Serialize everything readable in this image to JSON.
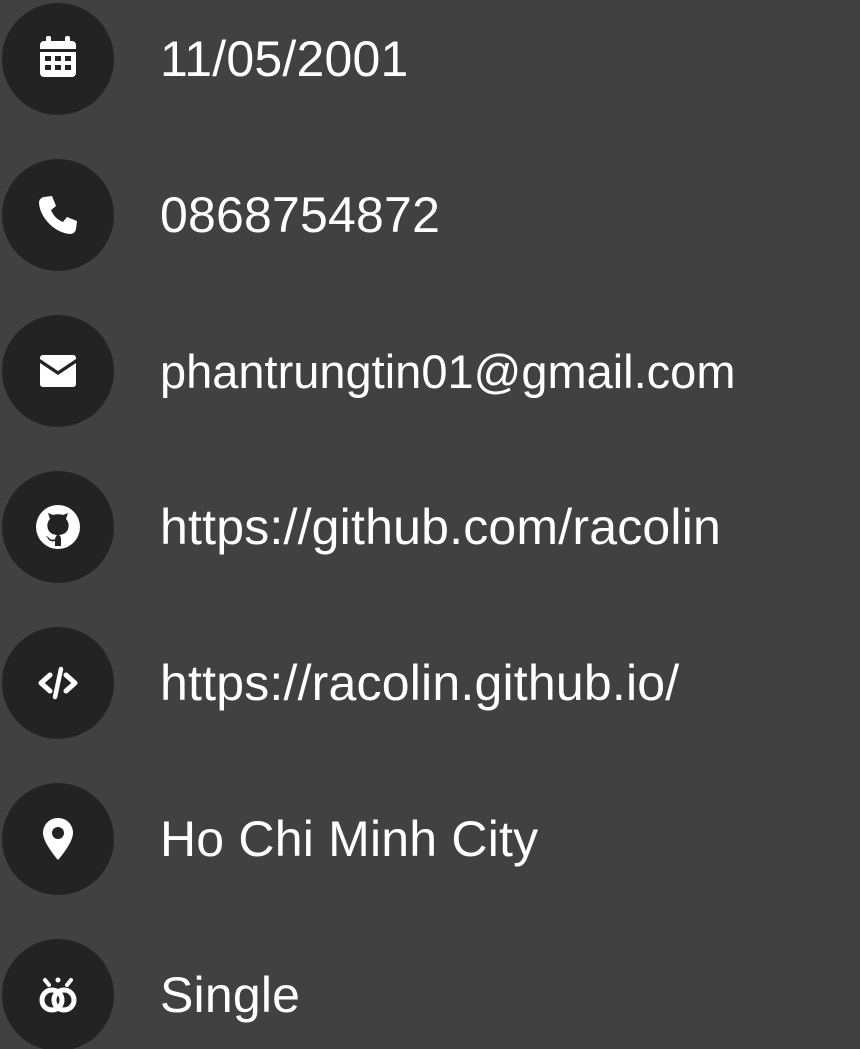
{
  "colors": {
    "background": "#414141",
    "icon_circle": "#232323",
    "foreground": "#ffffff"
  },
  "items": [
    {
      "icon": "calendar-icon",
      "text": "11/05/2001"
    },
    {
      "icon": "phone-icon",
      "text": "0868754872"
    },
    {
      "icon": "envelope-icon",
      "text": "phantrungtin01@gmail.com"
    },
    {
      "icon": "github-icon",
      "text": "https://github.com/racolin"
    },
    {
      "icon": "code-icon",
      "text": "https://racolin.github.io/"
    },
    {
      "icon": "location-pin-icon",
      "text": "Ho Chi Minh City"
    },
    {
      "icon": "rings-icon",
      "text": "Single"
    }
  ]
}
